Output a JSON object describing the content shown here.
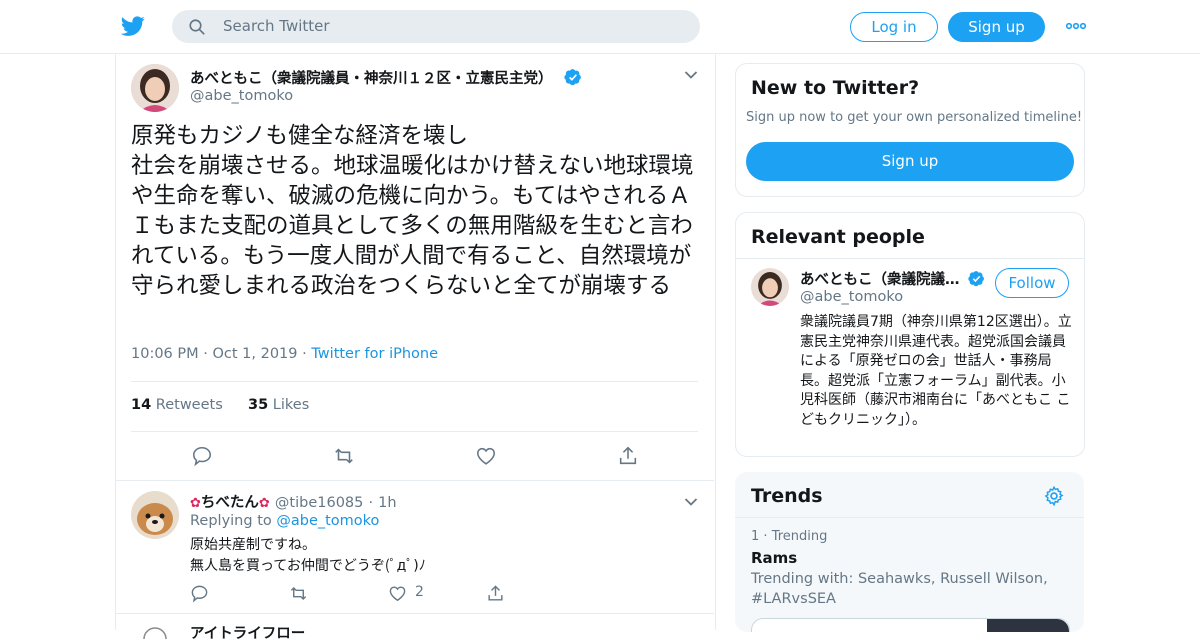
{
  "header": {
    "search_placeholder": "Search Twitter",
    "login_label": "Log in",
    "signup_label": "Sign up",
    "brand_color": "#1da1f2"
  },
  "tweet": {
    "author_name": "あべともこ（衆議院議員・神奈川１２区・立憲民主党）",
    "author_handle": "@abe_tomoko",
    "text": "原発もカジノも健全な経済を壊し\n社会を崩壊させる。地球温暖化はかけ替えない地球環境や生命を奪い、破滅の危機に向かう。もてはやされるＡＩもまた支配の道具として多くの無用階級を生むと言われている。もう一度人間が人間で有ること、自然環境が守られ愛しまれる政治をつくらないと全てが崩壊する",
    "time": "10:06 PM",
    "date": "Oct 1, 2019",
    "source": "Twitter for iPhone",
    "retweets_count": "14",
    "retweets_label": "Retweets",
    "likes_count": "35",
    "likes_label": "Likes"
  },
  "reply": {
    "author_name": "ちべたん",
    "author_handle": "@tibe16085",
    "age": "1h",
    "replying_prefix": "Replying to",
    "replying_to": "@abe_tomoko",
    "text": "原始共産制ですね。\n無人島を買ってお仲間でどうぞ(ﾟдﾟ)ﾉ",
    "like_count": "2"
  },
  "next_reply": {
    "author_name": "アイトライフロー"
  },
  "new_to_twitter": {
    "title": "New to Twitter?",
    "subtitle": "Sign up now to get your own personalized timeline!",
    "button_label": "Sign up"
  },
  "relevant_people": {
    "title": "Relevant people",
    "name": "あべともこ（衆議院議…",
    "handle": "@abe_tomoko",
    "follow_label": "Follow",
    "bio": "衆議院議員7期（神奈川県第12区選出）。立憲民主党神奈川県連代表。超党派国会議員による「原発ゼロの会」世話人・事務局長。超党派「立憲フォーラム」副代表。小児科医師（藤沢市湘南台に「あべともこ こどもクリニック」）。"
  },
  "trends": {
    "title": "Trends",
    "items": [
      {
        "rank": "1",
        "context": "Trending",
        "name": "Rams",
        "with_label": "Trending with: Seahawks, Russell Wilson, #LARvsSEA"
      }
    ]
  }
}
